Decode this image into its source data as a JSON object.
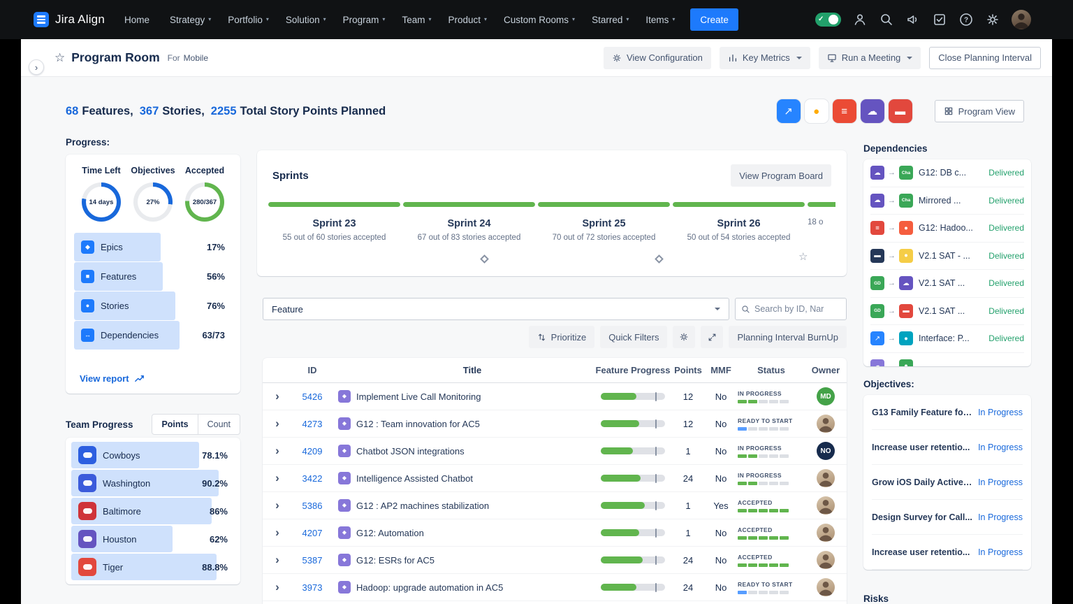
{
  "nav": {
    "brand": "Jira Align",
    "items": [
      {
        "label": "Home",
        "caret": ""
      },
      {
        "label": "Strategy",
        "caret": "▾"
      },
      {
        "label": "Portfolio",
        "caret": "▾"
      },
      {
        "label": "Solution",
        "caret": "▾"
      },
      {
        "label": "Program",
        "caret": "▾"
      },
      {
        "label": "Team",
        "caret": "▾"
      },
      {
        "label": "Product",
        "caret": "▾"
      },
      {
        "label": "Custom Rooms",
        "caret": "▾"
      },
      {
        "label": "Starred",
        "caret": "▾"
      },
      {
        "label": "Items",
        "caret": "▾"
      }
    ],
    "create_label": "Create"
  },
  "header": {
    "title": "Program Room",
    "for_label": "For",
    "context": "Mobile",
    "view_configuration": "View Configuration",
    "key_metrics": "Key Metrics",
    "run_a_meeting": "Run a Meeting",
    "close_pi": "Close Planning Interval"
  },
  "summary": {
    "parts": [
      {
        "num": "68",
        "label": "Features,"
      },
      {
        "num": "367",
        "label": "Stories,"
      },
      {
        "num": "2255",
        "label": "Total Story Points Planned"
      }
    ],
    "app_icons": [
      {
        "bg": "#2684ff",
        "glyph": "↗"
      },
      {
        "bg": "#ffffff",
        "glyph": "●",
        "fg": "#ffab00"
      },
      {
        "bg": "#eb4b35",
        "glyph": "≡"
      },
      {
        "bg": "#6554c0",
        "glyph": "☁"
      },
      {
        "bg": "#e2483d",
        "glyph": "▬"
      }
    ],
    "program_view": "Program View"
  },
  "progress": {
    "heading": "Progress:",
    "donuts": [
      {
        "label": "Time Left",
        "value": "14 days",
        "ring": {
          "pct": 78,
          "color": "#1868db"
        }
      },
      {
        "label": "Objectives",
        "value": "27%",
        "ring": {
          "pct": 27,
          "color": "#1868db"
        }
      },
      {
        "label": "Accepted",
        "value": "280/367",
        "ring": {
          "pct": 76,
          "color": "#61b54e"
        }
      }
    ],
    "rows": [
      {
        "icon": "◆",
        "label": "Epics",
        "value": "17%",
        "fill": 55
      },
      {
        "icon": "■",
        "label": "Features",
        "value": "56%",
        "fill": 56
      },
      {
        "icon": "●",
        "label": "Stories",
        "value": "76%",
        "fill": 64
      },
      {
        "icon": "↔",
        "label": "Dependencies",
        "value": "63/73",
        "fill": 67
      }
    ],
    "view_report": "View report"
  },
  "team": {
    "heading": "Team Progress",
    "tab_points": "Points",
    "tab_count": "Count",
    "rows": [
      {
        "name": "Cowboys",
        "value": "78.1%",
        "fill": 78,
        "bg": "#2d5fe0"
      },
      {
        "name": "Washington",
        "value": "90.2%",
        "fill": 90,
        "bg": "#3b5bdb"
      },
      {
        "name": "Baltimore",
        "value": "86%",
        "fill": 86,
        "bg": "#cf3339"
      },
      {
        "name": "Houston",
        "value": "62%",
        "fill": 62,
        "bg": "#6554c0"
      },
      {
        "name": "Tiger",
        "value": "88.8%",
        "fill": 89,
        "bg": "#e2483d"
      }
    ]
  },
  "sprints": {
    "heading": "Sprints",
    "view_board": "View Program Board",
    "items": [
      {
        "name": "Sprint 23",
        "sub": "55 out of 60 stories accepted",
        "bar": 100
      },
      {
        "name": "Sprint 24",
        "sub": "67 out of 83 stories accepted",
        "bar": 100
      },
      {
        "name": "Sprint 25",
        "sub": "70 out of 72 stories accepted",
        "bar": 100
      },
      {
        "name": "Sprint 26",
        "sub": "50 out of 54 stories accepted",
        "bar": 100
      },
      {
        "name": "",
        "sub": "18 o",
        "bar": 100
      }
    ]
  },
  "filters": {
    "type_value": "Feature",
    "search_placeholder": "Search by ID, Nar",
    "prioritize": "Prioritize",
    "quick_filters": "Quick Filters",
    "burnup": "Planning Interval BurnUp"
  },
  "table": {
    "headers": {
      "id": "ID",
      "title": "Title",
      "progress": "Feature Progress",
      "points": "Points",
      "mmf": "MMF",
      "status": "Status",
      "owner": "Owner"
    },
    "rows": [
      {
        "id": "5426",
        "title": "Implement Live Call Monitoring",
        "progress": 55,
        "points": "12",
        "mmf": "No",
        "status": {
          "label": "IN PROGRESS",
          "filled": 2,
          "color": "#61b54e"
        },
        "owner": {
          "text": "MD",
          "bg": "#44a248"
        }
      },
      {
        "id": "4273",
        "title": "G12 : Team innovation for AC5",
        "progress": 60,
        "points": "12",
        "mmf": "No",
        "status": {
          "label": "READY TO START",
          "filled": 1,
          "color": "#579dff"
        },
        "owner": {}
      },
      {
        "id": "4209",
        "title": "Chatbot JSON integrations",
        "progress": 50,
        "points": "1",
        "mmf": "No",
        "status": {
          "label": "IN PROGRESS",
          "filled": 2,
          "color": "#61b54e"
        },
        "owner": {
          "text": "NO",
          "bg": "#172b4d"
        }
      },
      {
        "id": "3422",
        "title": "Intelligence Assisted Chatbot",
        "progress": 62,
        "points": "24",
        "mmf": "No",
        "status": {
          "label": "IN PROGRESS",
          "filled": 2,
          "color": "#61b54e"
        },
        "owner": {}
      },
      {
        "id": "5386",
        "title": "G12 : AP2 machines stabilization",
        "progress": 68,
        "points": "1",
        "mmf": "Yes",
        "status": {
          "label": "ACCEPTED",
          "filled": 5,
          "color": "#61b54e"
        },
        "owner": {}
      },
      {
        "id": "4207",
        "title": "G12: Automation",
        "progress": 60,
        "points": "1",
        "mmf": "No",
        "status": {
          "label": "ACCEPTED",
          "filled": 5,
          "color": "#61b54e"
        },
        "owner": {}
      },
      {
        "id": "5387",
        "title": "G12: ESRs for AC5",
        "progress": 65,
        "points": "24",
        "mmf": "No",
        "status": {
          "label": "ACCEPTED",
          "filled": 5,
          "color": "#61b54e"
        },
        "owner": {}
      },
      {
        "id": "3973",
        "title": "Hadoop: upgrade automation in AC5",
        "progress": 55,
        "points": "24",
        "mmf": "No",
        "status": {
          "label": "READY TO START",
          "filled": 1,
          "color": "#579dff"
        },
        "owner": {}
      }
    ]
  },
  "dependencies": {
    "heading": "Dependencies",
    "rows": [
      {
        "from": {
          "bg": "#6554c0",
          "glyph": "☁",
          "label": ""
        },
        "to": {
          "bg": "#3aa757",
          "glyph": "",
          "label": "Cha"
        },
        "title": "G12: DB c...",
        "status": "Delivered"
      },
      {
        "from": {
          "bg": "#6554c0",
          "glyph": "☁",
          "label": ""
        },
        "to": {
          "bg": "#3aa757",
          "glyph": "",
          "label": "Cha"
        },
        "title": "Mirrored ...",
        "status": "Delivered"
      },
      {
        "from": {
          "bg": "#e2483d",
          "glyph": "≡",
          "label": ""
        },
        "to": {
          "bg": "#f55d3e",
          "glyph": "●",
          "label": ""
        },
        "title": "G12: Hadoo...",
        "status": "Delivered"
      },
      {
        "from": {
          "bg": "#253858",
          "glyph": "▬",
          "label": ""
        },
        "to": {
          "bg": "#f5cd47",
          "glyph": "●",
          "label": ""
        },
        "title": "V2.1 SAT - ...",
        "status": "Delivered"
      },
      {
        "from": {
          "bg": "#3aa757",
          "glyph": "",
          "label": "GD"
        },
        "to": {
          "bg": "#6554c0",
          "glyph": "☁",
          "label": ""
        },
        "title": "V2.1 SAT ...",
        "status": "Delivered"
      },
      {
        "from": {
          "bg": "#3aa757",
          "glyph": "",
          "label": "GD"
        },
        "to": {
          "bg": "#e2483d",
          "glyph": "▬",
          "label": ""
        },
        "title": "V2.1 SAT ...",
        "status": "Delivered"
      },
      {
        "from": {
          "bg": "#2684ff",
          "glyph": "↗",
          "label": ""
        },
        "to": {
          "bg": "#00a3bf",
          "glyph": "●",
          "label": ""
        },
        "title": "Interface: P...",
        "status": "Delivered"
      },
      {
        "from": {
          "bg": "#8777d9",
          "glyph": "☁",
          "label": ""
        },
        "to": {
          "bg": "#3aa757",
          "glyph": "●",
          "label": ""
        },
        "title": "",
        "status": ""
      }
    ]
  },
  "objectives": {
    "heading": "Objectives:",
    "rows": [
      {
        "title": "G13 Family Feature for...",
        "status": "In Progress"
      },
      {
        "title": "Increase user retentio...",
        "status": "In Progress"
      },
      {
        "title": "Grow iOS Daily Active ...",
        "status": "In Progress"
      },
      {
        "title": "Design Survey for Call...",
        "status": "In Progress"
      },
      {
        "title": "Increase user retentio...",
        "status": "In Progress"
      }
    ]
  },
  "risks": {
    "heading": "Risks"
  }
}
